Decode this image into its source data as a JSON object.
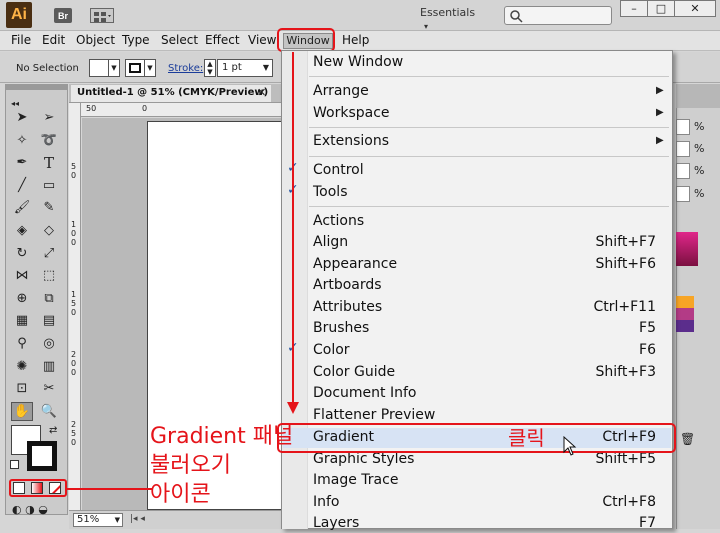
{
  "app": {
    "logo": "Ai",
    "bridge_badge": "Br",
    "workspace": "Essentials",
    "window_controls": [
      "–",
      "□",
      "✕"
    ]
  },
  "menubar": {
    "items": [
      "File",
      "Edit",
      "Object",
      "Type",
      "Select",
      "Effect",
      "View",
      "Window",
      "Help"
    ]
  },
  "controlbar": {
    "selection": "No Selection",
    "stroke_label": "Stroke:",
    "stroke_weight": "1 pt"
  },
  "document": {
    "tab_title": "Untitled-1 @ 51% (CMYK/Preview)",
    "zoom": "51%",
    "ruler_top_labels": [
      "50",
      "0"
    ],
    "ruler_left_labels": [
      "5\n0",
      "1\n0\n0",
      "1\n5\n0",
      "2\n0\n0",
      "2\n5\n0"
    ]
  },
  "window_menu": {
    "items": [
      {
        "label": "New Window",
        "shortcut": ""
      },
      {
        "label": "Arrange",
        "shortcut": "",
        "submenu": true
      },
      {
        "label": "Workspace",
        "shortcut": "",
        "submenu": true
      },
      {
        "label": "Extensions",
        "shortcut": "",
        "submenu": true
      },
      {
        "label": "Control",
        "shortcut": "",
        "checked": true
      },
      {
        "label": "Tools",
        "shortcut": "",
        "checked": true
      },
      {
        "label": "Actions",
        "shortcut": ""
      },
      {
        "label": "Align",
        "shortcut": "Shift+F7"
      },
      {
        "label": "Appearance",
        "shortcut": "Shift+F6"
      },
      {
        "label": "Artboards",
        "shortcut": ""
      },
      {
        "label": "Attributes",
        "shortcut": "Ctrl+F11"
      },
      {
        "label": "Brushes",
        "shortcut": "F5"
      },
      {
        "label": "Color",
        "shortcut": "F6",
        "checked": true
      },
      {
        "label": "Color Guide",
        "shortcut": "Shift+F3"
      },
      {
        "label": "Document Info",
        "shortcut": ""
      },
      {
        "label": "Flattener Preview",
        "shortcut": ""
      },
      {
        "label": "Gradient",
        "shortcut": "Ctrl+F9",
        "highlighted": true
      },
      {
        "label": "Graphic Styles",
        "shortcut": "Shift+F5"
      },
      {
        "label": "Image Trace",
        "shortcut": ""
      },
      {
        "label": "Info",
        "shortcut": "Ctrl+F8"
      },
      {
        "label": "Layers",
        "shortcut": "F7"
      }
    ]
  },
  "annotations": {
    "click": "클릭",
    "gradient_icon_line1": "Gradient 패널",
    "gradient_icon_line2": "불러오기",
    "gradient_icon_line3": "아이콘"
  },
  "right_panel": {
    "percent_sign": "%"
  },
  "colors": {
    "annotation_red": "#e5141a",
    "menu_highlight": "#d7e3f4",
    "check_blue": "#1f4f9f"
  }
}
